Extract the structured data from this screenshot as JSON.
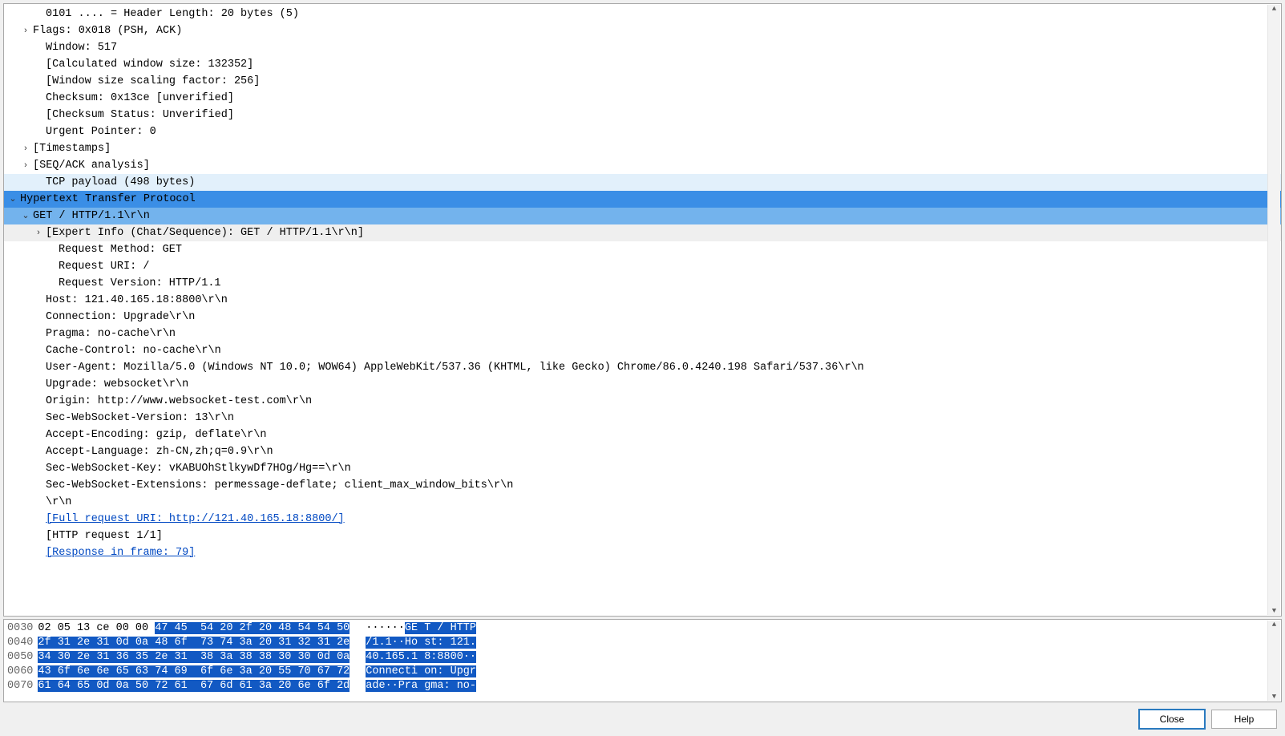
{
  "details": {
    "tcp_items": [
      {
        "indent": 2,
        "disc": "none",
        "text": "0101 .... = Header Length: 20 bytes (5)"
      },
      {
        "indent": 1,
        "disc": "closed",
        "text": "Flags: 0x018 (PSH, ACK)"
      },
      {
        "indent": 2,
        "disc": "none",
        "text": "Window: 517"
      },
      {
        "indent": 2,
        "disc": "none",
        "text": "[Calculated window size: 132352]"
      },
      {
        "indent": 2,
        "disc": "none",
        "text": "[Window size scaling factor: 256]"
      },
      {
        "indent": 2,
        "disc": "none",
        "text": "Checksum: 0x13ce [unverified]"
      },
      {
        "indent": 2,
        "disc": "none",
        "text": "[Checksum Status: Unverified]"
      },
      {
        "indent": 2,
        "disc": "none",
        "text": "Urgent Pointer: 0"
      },
      {
        "indent": 1,
        "disc": "closed",
        "text": "[Timestamps]"
      },
      {
        "indent": 1,
        "disc": "closed",
        "text": "[SEQ/ACK analysis]"
      },
      {
        "indent": 2,
        "disc": "none",
        "text": "TCP payload (498 bytes)",
        "hl": "paleblue"
      }
    ],
    "http_header": {
      "indent": 0,
      "disc": "open",
      "text": "Hypertext Transfer Protocol",
      "hl": "blue"
    },
    "request_line": {
      "indent": 1,
      "disc": "open",
      "text": "GET / HTTP/1.1\\r\\n",
      "hl": "lightblue"
    },
    "expert_info": {
      "indent": 2,
      "disc": "closed",
      "text": "[Expert Info (Chat/Sequence): GET / HTTP/1.1\\r\\n]",
      "hl": "grey"
    },
    "http_sub": [
      {
        "indent": 3,
        "disc": "none",
        "text": "Request Method: GET"
      },
      {
        "indent": 3,
        "disc": "none",
        "text": "Request URI: /"
      },
      {
        "indent": 3,
        "disc": "none",
        "text": "Request Version: HTTP/1.1"
      }
    ],
    "http_headers": [
      {
        "text": "Host: 121.40.165.18:8800\\r\\n"
      },
      {
        "text": "Connection: Upgrade\\r\\n"
      },
      {
        "text": "Pragma: no-cache\\r\\n"
      },
      {
        "text": "Cache-Control: no-cache\\r\\n"
      },
      {
        "text": "User-Agent: Mozilla/5.0 (Windows NT 10.0; WOW64) AppleWebKit/537.36 (KHTML, like Gecko) Chrome/86.0.4240.198 Safari/537.36\\r\\n"
      },
      {
        "text": "Upgrade: websocket\\r\\n"
      },
      {
        "text": "Origin: http://www.websocket-test.com\\r\\n"
      },
      {
        "text": "Sec-WebSocket-Version: 13\\r\\n"
      },
      {
        "text": "Accept-Encoding: gzip, deflate\\r\\n"
      },
      {
        "text": "Accept-Language: zh-CN,zh;q=0.9\\r\\n"
      },
      {
        "text": "Sec-WebSocket-Key: vKABUOhStlkywDf7HOg/Hg==\\r\\n"
      },
      {
        "text": "Sec-WebSocket-Extensions: permessage-deflate; client_max_window_bits\\r\\n"
      },
      {
        "text": "\\r\\n"
      }
    ],
    "full_uri": {
      "text": "[Full request URI: http://121.40.165.18:8800/]",
      "link": true
    },
    "req_count": {
      "text": "[HTTP request 1/1]"
    },
    "response_in": {
      "text": "[Response in frame: 79]",
      "link": true
    }
  },
  "bytes": [
    {
      "off": "0030",
      "plainHex": "02 05 13 ce 00 00 ",
      "selHex": "47 45  54 20 2f 20 48 54 54 50",
      "plainAsc": "······",
      "selAsc": "GE T / HTTP"
    },
    {
      "off": "0040",
      "plainHex": "",
      "selHex": "2f 31 2e 31 0d 0a 48 6f  73 74 3a 20 31 32 31 2e",
      "plainAsc": "",
      "selAsc": "/1.1··Ho st: 121."
    },
    {
      "off": "0050",
      "plainHex": "",
      "selHex": "34 30 2e 31 36 35 2e 31  38 3a 38 38 30 30 0d 0a",
      "plainAsc": "",
      "selAsc": "40.165.1 8:8800··"
    },
    {
      "off": "0060",
      "plainHex": "",
      "selHex": "43 6f 6e 6e 65 63 74 69  6f 6e 3a 20 55 70 67 72",
      "plainAsc": "",
      "selAsc": "Connecti on: Upgr"
    },
    {
      "off": "0070",
      "plainHex": "",
      "selHex": "61 64 65 0d 0a 50 72 61  67 6d 61 3a 20 6e 6f 2d",
      "plainAsc": "",
      "selAsc": "ade··Pra gma: no-"
    }
  ],
  "buttons": {
    "close": "Close",
    "help": "Help"
  }
}
